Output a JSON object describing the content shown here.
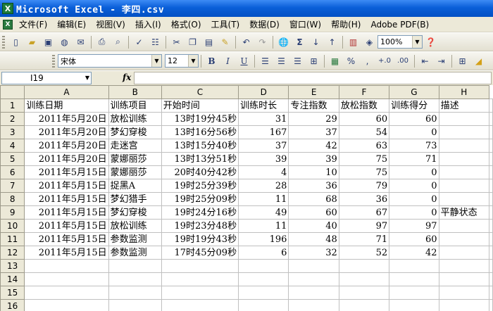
{
  "window": {
    "title": "Microsoft Excel - 李四.csv",
    "icon": "X"
  },
  "menu": [
    "文件(F)",
    "编辑(E)",
    "视图(V)",
    "插入(I)",
    "格式(O)",
    "工具(T)",
    "数据(D)",
    "窗口(W)",
    "帮助(H)",
    "Adobe PDF(B)"
  ],
  "standard_toolbar": {
    "zoom": "100%"
  },
  "formatting_toolbar": {
    "font": "宋体",
    "size": "12",
    "bold": "B",
    "italic": "I",
    "underline": "U",
    "percent": "%",
    "comma": ",",
    "inc_decimal": "+.0",
    "dec_decimal": ".00"
  },
  "formula_bar": {
    "name_box": "I19",
    "fx": "fx",
    "content": ""
  },
  "sheet": {
    "columns": [
      "A",
      "B",
      "C",
      "D",
      "E",
      "F",
      "G",
      "H"
    ],
    "row_numbers": [
      "1",
      "2",
      "3",
      "4",
      "5",
      "6",
      "7",
      "8",
      "9",
      "10",
      "11",
      "12",
      "13",
      "14",
      "15",
      "16"
    ],
    "header_row": [
      "训练日期",
      "训练项目",
      "开始时间",
      "训练时长",
      "专注指数",
      "放松指数",
      "训练得分",
      "描述"
    ],
    "rows": [
      [
        "2011年5月20日",
        "放松训练",
        "13时19分45秒",
        "31",
        "29",
        "60",
        "60",
        ""
      ],
      [
        "2011年5月20日",
        "梦幻穿梭",
        "13时16分56秒",
        "167",
        "37",
        "54",
        "0",
        ""
      ],
      [
        "2011年5月20日",
        "走迷宫",
        "13时15分40秒",
        "37",
        "42",
        "63",
        "73",
        ""
      ],
      [
        "2011年5月20日",
        "蒙娜丽莎",
        "13时13分51秒",
        "39",
        "39",
        "75",
        "71",
        ""
      ],
      [
        "2011年5月15日",
        "蒙娜丽莎",
        "20时40分42秒",
        "4",
        "10",
        "75",
        "0",
        ""
      ],
      [
        "2011年5月15日",
        "捉黑A",
        "19时25分39秒",
        "28",
        "36",
        "79",
        "0",
        ""
      ],
      [
        "2011年5月15日",
        "梦幻猎手",
        "19时25分09秒",
        "11",
        "68",
        "36",
        "0",
        ""
      ],
      [
        "2011年5月15日",
        "梦幻穿梭",
        "19时24分16秒",
        "49",
        "60",
        "67",
        "0",
        "平静状态"
      ],
      [
        "2011年5月15日",
        "放松训练",
        "19时23分48秒",
        "11",
        "40",
        "97",
        "97",
        ""
      ],
      [
        "2011年5月15日",
        "参数监测",
        "19时19分43秒",
        "196",
        "48",
        "71",
        "60",
        ""
      ],
      [
        "2011年5月15日",
        "参数监测",
        "17时45分09秒",
        "6",
        "32",
        "52",
        "42",
        ""
      ]
    ]
  }
}
